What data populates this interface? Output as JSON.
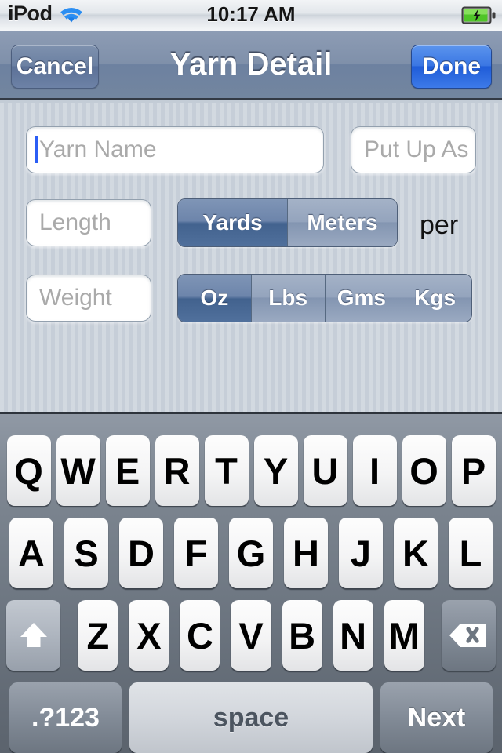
{
  "status_bar": {
    "carrier": "iPod",
    "wifi_icon": "wifi-icon",
    "time": "10:17 AM",
    "battery_icon": "battery-charging-icon"
  },
  "nav_bar": {
    "cancel_label": "Cancel",
    "title": "Yarn Detail",
    "done_label": "Done"
  },
  "form": {
    "yarn_name": {
      "value": "",
      "placeholder": "Yarn Name"
    },
    "put_up_as": {
      "value": "",
      "placeholder": "Put Up As"
    },
    "length": {
      "value": "",
      "placeholder": "Length"
    },
    "weight": {
      "value": "",
      "placeholder": "Weight"
    },
    "per_label": "per",
    "length_units": {
      "options": [
        "Yards",
        "Meters"
      ],
      "selected": "Yards"
    },
    "weight_units": {
      "options": [
        "Oz",
        "Lbs",
        "Gms",
        "Kgs"
      ],
      "selected": "Oz"
    }
  },
  "keyboard": {
    "row1": [
      "Q",
      "W",
      "E",
      "R",
      "T",
      "Y",
      "U",
      "I",
      "O",
      "P"
    ],
    "row2": [
      "A",
      "S",
      "D",
      "F",
      "G",
      "H",
      "J",
      "K",
      "L"
    ],
    "row3": [
      "Z",
      "X",
      "C",
      "V",
      "B",
      "N",
      "M"
    ],
    "shift_icon": "shift-arrow-icon",
    "delete_icon": "delete-backspace-icon",
    "numbers_label": ".?123",
    "space_label": "space",
    "return_label": "Next"
  },
  "colors": {
    "accent_blue": "#2b5ef5",
    "done_blue": "#3a76e3",
    "nav_blue_gray": "#7f90aa",
    "segment_selected": "#42628e",
    "form_background": "#c6ced8"
  }
}
